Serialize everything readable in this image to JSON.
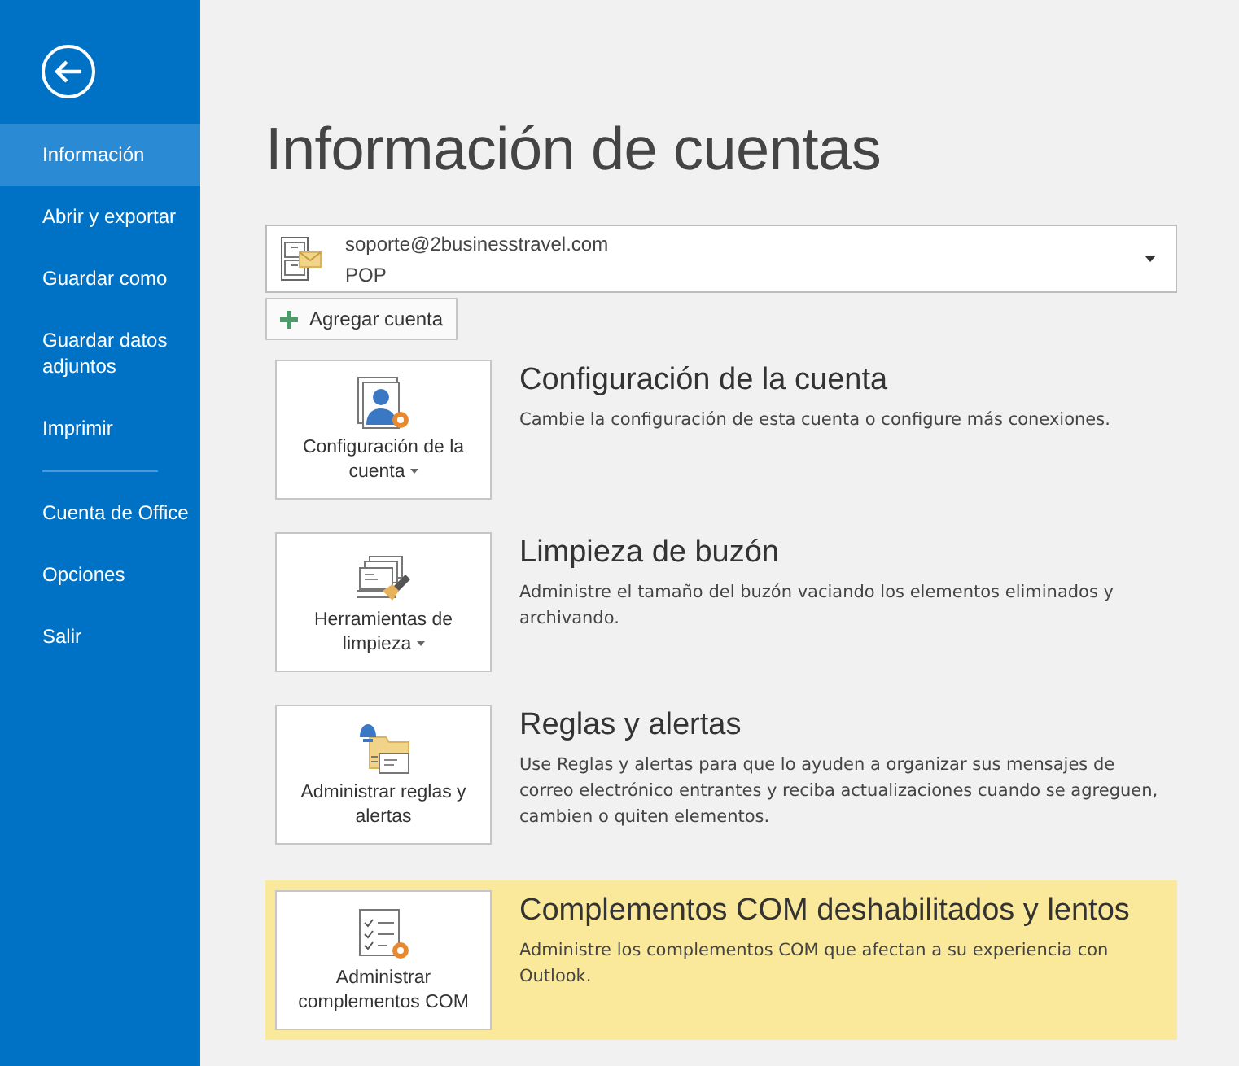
{
  "sidebar": {
    "items": [
      {
        "label": "Información",
        "selected": true,
        "divider_before": false
      },
      {
        "label": "Abrir y exportar",
        "selected": false,
        "divider_before": false
      },
      {
        "label": "Guardar como",
        "selected": false,
        "divider_before": false
      },
      {
        "label": "Guardar datos adjuntos",
        "selected": false,
        "divider_before": false
      },
      {
        "label": "Imprimir",
        "selected": false,
        "divider_before": false
      },
      {
        "label": "Cuenta de Office",
        "selected": false,
        "divider_before": true
      },
      {
        "label": "Opciones",
        "selected": false,
        "divider_before": false
      },
      {
        "label": "Salir",
        "selected": false,
        "divider_before": false
      }
    ]
  },
  "title": "Información de cuentas",
  "account": {
    "email": "soporte@2businesstravel.com",
    "type": "POP"
  },
  "add_account_button": "Agregar cuenta",
  "sections": [
    {
      "kind": "account",
      "tile_label": "Configuración de la cuenta",
      "dropdown": true,
      "highlighted": false,
      "heading": "Configuración de la cuenta",
      "description": "Cambie la configuración de esta cuenta o configure más conexiones."
    },
    {
      "kind": "cleanup",
      "tile_label": "Herramientas de limpieza",
      "dropdown": true,
      "highlighted": false,
      "heading": "Limpieza de buzón",
      "description": "Administre el tamaño del buzón vaciando los elementos eliminados y archivando."
    },
    {
      "kind": "rules",
      "tile_label": "Administrar reglas y alertas",
      "dropdown": false,
      "highlighted": false,
      "heading": "Reglas y alertas",
      "description": "Use Reglas y alertas para que lo ayuden a organizar sus mensajes de correo electrónico entrantes y reciba actualizaciones cuando se agreguen, cambien o quiten elementos."
    },
    {
      "kind": "addins",
      "tile_label": "Administrar complementos COM",
      "dropdown": false,
      "highlighted": true,
      "heading": "Complementos COM deshabilitados y lentos",
      "description": "Administre los complementos COM que afectan a su experiencia con Outlook."
    }
  ]
}
